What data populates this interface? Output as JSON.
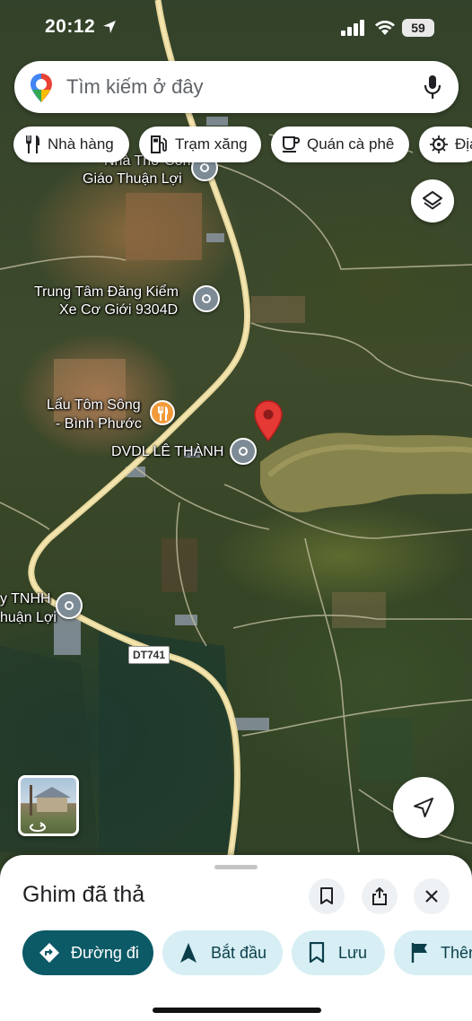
{
  "status_bar": {
    "time": "20:12",
    "battery": "59"
  },
  "search": {
    "placeholder": "Tìm kiếm ở đây"
  },
  "chips": [
    {
      "label": "Nhà hàng",
      "icon": "restaurant-icon"
    },
    {
      "label": "Trạm xăng",
      "icon": "gas-station-icon"
    },
    {
      "label": "Quán cà phê",
      "icon": "coffee-icon"
    },
    {
      "label": "Địa",
      "icon": "attraction-icon"
    }
  ],
  "map": {
    "labels": {
      "church_line1": "Nhà Thờ Công",
      "church_line2": "Giáo Thuận Lợi",
      "inspection_line1": "Trung Tâm Đăng Kiểm",
      "inspection_line2": "Xe Cơ Giới 9304D",
      "restaurant_line1": "Lẩu Tôm Sông",
      "restaurant_line2": "- Bình Phước",
      "driving_school": "DVDL LÊ THÀNH",
      "company_line1": "y TNHH",
      "company_line2": "huận Lợi",
      "route_shield": "DT741"
    },
    "colors": {
      "pin": "#e53935",
      "road": "#e8d79c",
      "poi_gray": "#7d8b96",
      "poi_orange": "#f29a3a"
    }
  },
  "sheet": {
    "title": "Ghim đã thả",
    "actions": {
      "directions": "Đường đi",
      "start": "Bắt đầu",
      "save": "Lưu",
      "add": "Thêm"
    }
  }
}
